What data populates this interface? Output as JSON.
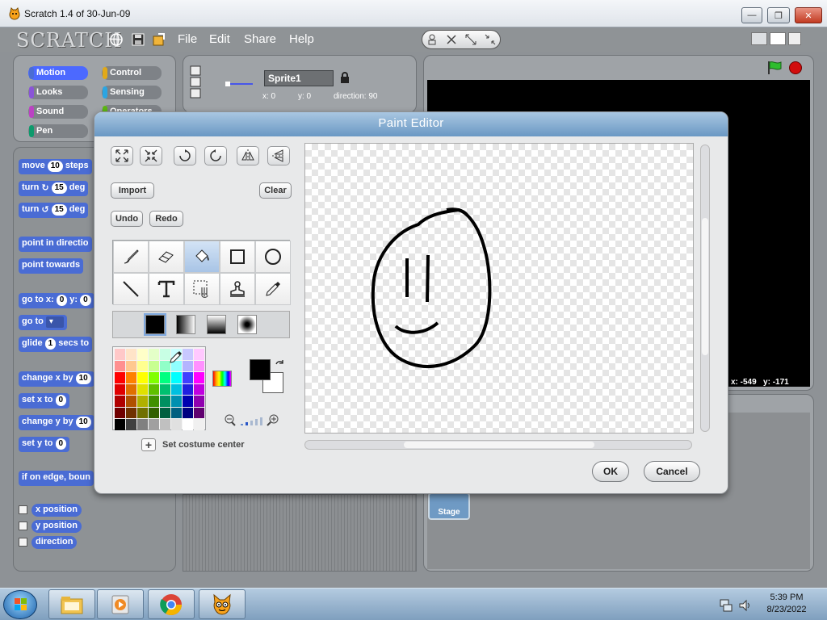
{
  "window": {
    "title": "Scratch 1.4 of 30-Jun-09"
  },
  "menubar": {
    "logo": "SCRATCH",
    "menus": [
      "File",
      "Edit",
      "Share",
      "Help"
    ]
  },
  "categories": [
    "Motion",
    "Looks",
    "Sound",
    "Pen",
    "Control",
    "Sensing",
    "Operators"
  ],
  "palette": {
    "move": {
      "a": "move",
      "n": "10",
      "b": "steps"
    },
    "turn_cw": {
      "a": "turn",
      "n": "15",
      "b": "deg"
    },
    "turn_ccw": {
      "a": "turn",
      "n": "15",
      "b": "deg"
    },
    "point_dir": "point in directio",
    "point_towards": "point towards",
    "goto_xy": {
      "a": "go to x:",
      "n": "0",
      "b": "y:",
      "n2": "0"
    },
    "goto": "go to",
    "glide": {
      "a": "glide",
      "n": "1",
      "b": "secs to"
    },
    "change_x": {
      "a": "change x by",
      "n": "10"
    },
    "set_x": {
      "a": "set x to",
      "n": "0"
    },
    "change_y": {
      "a": "change y by",
      "n": "10"
    },
    "set_y": {
      "a": "set y to",
      "n": "0"
    },
    "edge_bounce": "if on edge, boun",
    "reporters": [
      "x position",
      "y position",
      "direction"
    ]
  },
  "sprite": {
    "name": "Sprite1",
    "x_label": "x: 0",
    "y_label": "y: 0",
    "dir_label": "direction: 90"
  },
  "stage": {
    "mouse_x": "x: -549",
    "mouse_y": "y: -171",
    "thumb_label": "Stage"
  },
  "paint_editor": {
    "title": "Paint Editor",
    "buttons": {
      "import": "Import",
      "clear": "Clear",
      "undo": "Undo",
      "redo": "Redo",
      "set_center": "Set costume center",
      "ok": "OK",
      "cancel": "Cancel"
    },
    "transform_icons": [
      "grow-icon",
      "shrink-icon",
      "rotate-cw-icon",
      "rotate-ccw-icon",
      "flip-horizontal-icon",
      "flip-vertical-icon"
    ],
    "tools": [
      "paintbrush-icon",
      "eraser-icon",
      "fill-bucket-icon",
      "rectangle-icon",
      "ellipse-icon",
      "line-icon",
      "text-icon",
      "select-icon",
      "stamp-icon",
      "eyedropper-icon"
    ],
    "active_tool": "fill-bucket-icon",
    "fill_modes": [
      "solid",
      "horizontal-gradient",
      "vertical-gradient",
      "radial-gradient"
    ],
    "selected_fill": "solid",
    "foreground_color": "#000000",
    "background_color": "#ffffff",
    "palette_colors": [
      "#ffc8c8",
      "#ffe4c8",
      "#ffffc8",
      "#e4ffc8",
      "#c8ffe4",
      "#c8ffff",
      "#c8c8ff",
      "#ffc8ff",
      "#ff9090",
      "#ffc890",
      "#ffff90",
      "#c8ff90",
      "#90ffc8",
      "#90ffff",
      "#b4b4ff",
      "#ff90ff",
      "#ff0000",
      "#ff8000",
      "#ffff00",
      "#80ff00",
      "#00ff80",
      "#00ffff",
      "#4040ff",
      "#ff00ff",
      "#e00000",
      "#e07000",
      "#e0e000",
      "#60c000",
      "#00c070",
      "#00c0e0",
      "#2020e0",
      "#c000e0",
      "#b00000",
      "#b05000",
      "#b0b000",
      "#409000",
      "#009060",
      "#0090b0",
      "#0000b0",
      "#9000b0",
      "#700000",
      "#703000",
      "#707000",
      "#306000",
      "#006040",
      "#006080",
      "#000080",
      "#600070",
      "#000000",
      "#404040",
      "#808080",
      "#a0a0a0",
      "#c0c0c0",
      "#e0e0e0",
      "#ffffff",
      "#f0f0f0"
    ]
  },
  "taskbar": {
    "time": "5:39 PM",
    "date": "8/23/2022",
    "apps": [
      "file-explorer-icon",
      "media-player-icon",
      "chrome-icon",
      "scratch-cat-icon"
    ]
  }
}
